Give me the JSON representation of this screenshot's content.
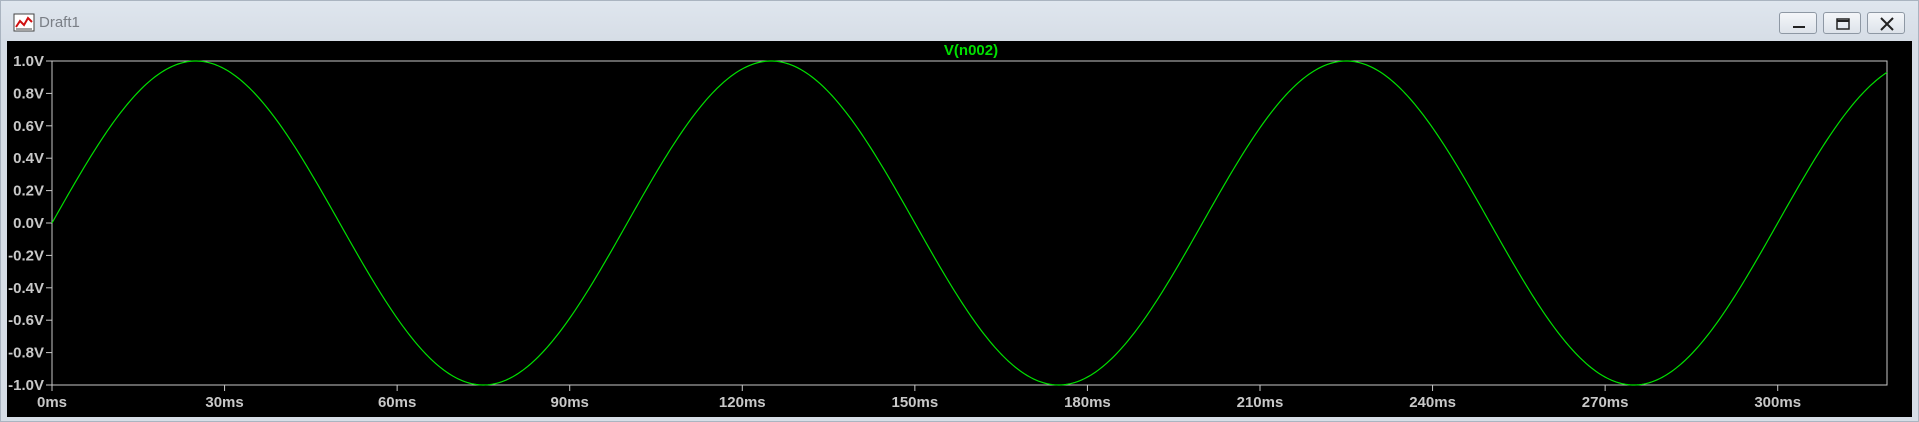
{
  "window": {
    "title": "Draft1",
    "icon": "waveform-plot-icon"
  },
  "controls": {
    "minimize_icon": "minimize-icon",
    "maximize_icon": "restore-icon",
    "close_icon": "close-icon"
  },
  "colors": {
    "background": "#000000",
    "trace": "#00e000",
    "axis_text": "#c8c8c8",
    "frame": "#c8c8c8"
  },
  "chart_data": {
    "type": "line",
    "title": "V(n002)",
    "series": [
      {
        "name": "V(n002)",
        "function": "sine",
        "amplitude": 1.0,
        "offset": 0.0,
        "frequency_hz": 10,
        "phase_deg": 0,
        "x_start_ms": 0,
        "x_end_ms": 319
      }
    ],
    "xlim": [
      0,
      319
    ],
    "ylim": [
      -1.0,
      1.0
    ],
    "x_ticks": [
      0,
      30,
      60,
      90,
      120,
      150,
      180,
      210,
      240,
      270,
      300
    ],
    "x_tick_labels": [
      "0ms",
      "30ms",
      "60ms",
      "90ms",
      "120ms",
      "150ms",
      "180ms",
      "210ms",
      "240ms",
      "270ms",
      "300ms"
    ],
    "y_ticks": [
      1.0,
      0.8,
      0.6,
      0.4,
      0.2,
      0.0,
      -0.2,
      -0.4,
      -0.6,
      -0.8,
      -1.0
    ],
    "y_tick_labels": [
      "1.0V",
      "0.8V",
      "0.6V",
      "0.4V",
      "0.2V",
      "0.0V",
      "-0.2V",
      "-0.4V",
      "-0.6V",
      "-0.8V",
      "-1.0V"
    ],
    "grid": false,
    "legend": "none"
  }
}
